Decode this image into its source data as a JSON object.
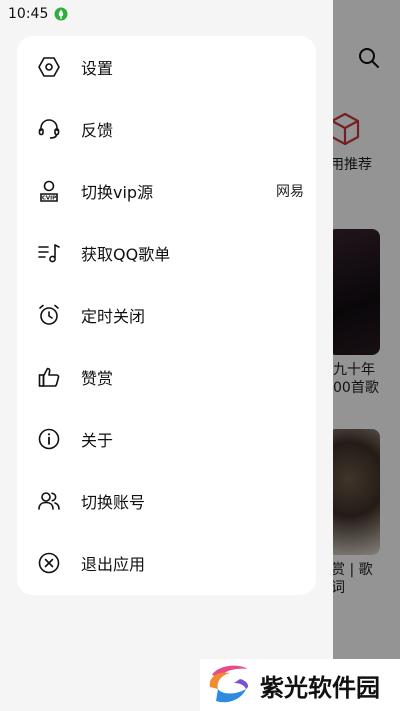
{
  "status_bar": {
    "time": "10:45"
  },
  "background": {
    "recommend_label": "用推荐",
    "card1_line1": "九十年",
    "card1_line2": "00首歌",
    "card2_line1": "赏 | 歌",
    "card2_line2": "词"
  },
  "menu": {
    "items": [
      {
        "label": "设置",
        "icon": "hexagon-settings-icon"
      },
      {
        "label": "反馈",
        "icon": "headset-icon"
      },
      {
        "label": "切换vip源",
        "icon": "user-vip-icon",
        "value": "网易"
      },
      {
        "label": "获取QQ歌单",
        "icon": "playlist-music-icon"
      },
      {
        "label": "定时关闭",
        "icon": "alarm-clock-icon"
      },
      {
        "label": "赞赏",
        "icon": "thumbs-up-icon"
      },
      {
        "label": "关于",
        "icon": "info-icon"
      },
      {
        "label": "切换账号",
        "icon": "users-icon"
      },
      {
        "label": "退出应用",
        "icon": "close-circle-icon"
      }
    ]
  },
  "watermark": {
    "text": "紫光软件园"
  },
  "colors": {
    "scrim": "rgba(0,0,0,0.42)",
    "drawer_bg": "#f5f5f5",
    "card_bg": "#ffffff",
    "accent_red": "#c8383c"
  }
}
